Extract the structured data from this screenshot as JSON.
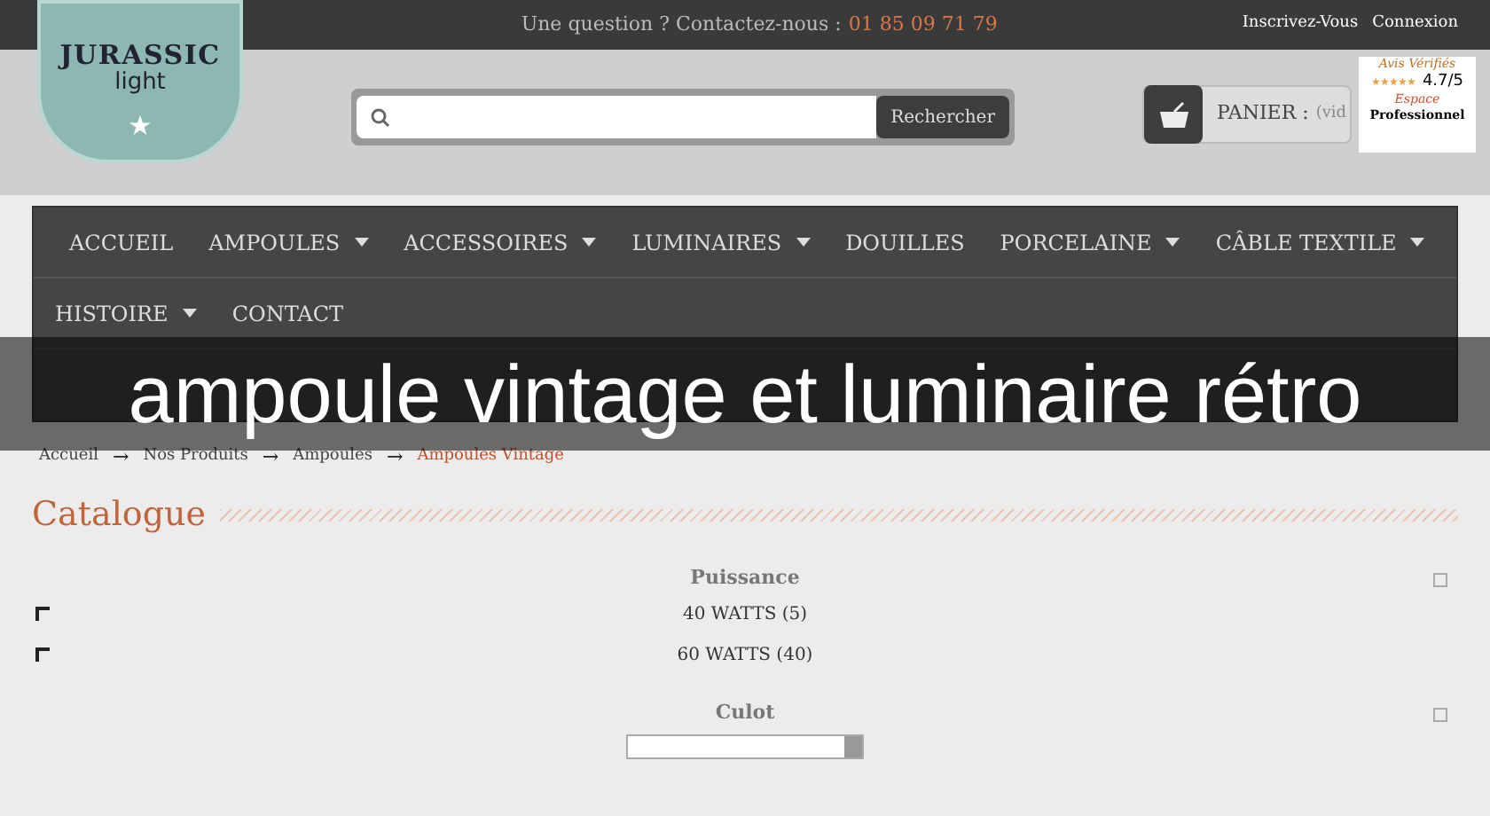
{
  "topbar": {
    "question": "Une question ? Contactez-nous :",
    "phone": "01 85 09 71 79",
    "links": [
      "Inscrivez-Vous",
      "Connexion"
    ]
  },
  "logo": {
    "line1": "JURASSIC",
    "line2": "light"
  },
  "search": {
    "button": "Rechercher"
  },
  "cart": {
    "label": "PANIER :",
    "status": "(vid"
  },
  "badge": {
    "brand": "Avis Vérifiés",
    "rating": "4.7/5",
    "stars": 5,
    "pro_line1": "Espace",
    "pro_line2": "Professionnel"
  },
  "nav": {
    "rows": [
      [
        {
          "label": "ACCUEIL",
          "dropdown": false
        },
        {
          "label": "AMPOULES",
          "dropdown": true
        },
        {
          "label": "ACCESSOIRES",
          "dropdown": true
        },
        {
          "label": "LUMINAIRES",
          "dropdown": true
        },
        {
          "label": "DOUILLES",
          "dropdown": false
        },
        {
          "label": "PORCELAINE",
          "dropdown": true
        },
        {
          "label": "CÂBLE TEXTILE",
          "dropdown": true
        }
      ],
      [
        {
          "label": "HISTOIRE",
          "dropdown": true
        },
        {
          "label": "CONTACT",
          "dropdown": false
        }
      ]
    ]
  },
  "caption": "ampoule vintage et luminaire rétro",
  "breadcrumb": [
    {
      "label": "Accueil",
      "selected": false
    },
    {
      "label": "Nos Produits",
      "selected": false
    },
    {
      "label": "Ampoules",
      "selected": false
    },
    {
      "label": "Ampoules Vintage",
      "selected": true
    }
  ],
  "breadcrumb_separator": "→",
  "catalogue": {
    "title": "Catalogue",
    "filters": [
      {
        "title": "Puissance",
        "kind": "checkbox",
        "options": [
          {
            "label": "40 WATTS (5)",
            "checked": false
          },
          {
            "label": "60 WATTS (40)",
            "checked": false
          }
        ]
      },
      {
        "title": "Culot",
        "kind": "select"
      }
    ]
  }
}
